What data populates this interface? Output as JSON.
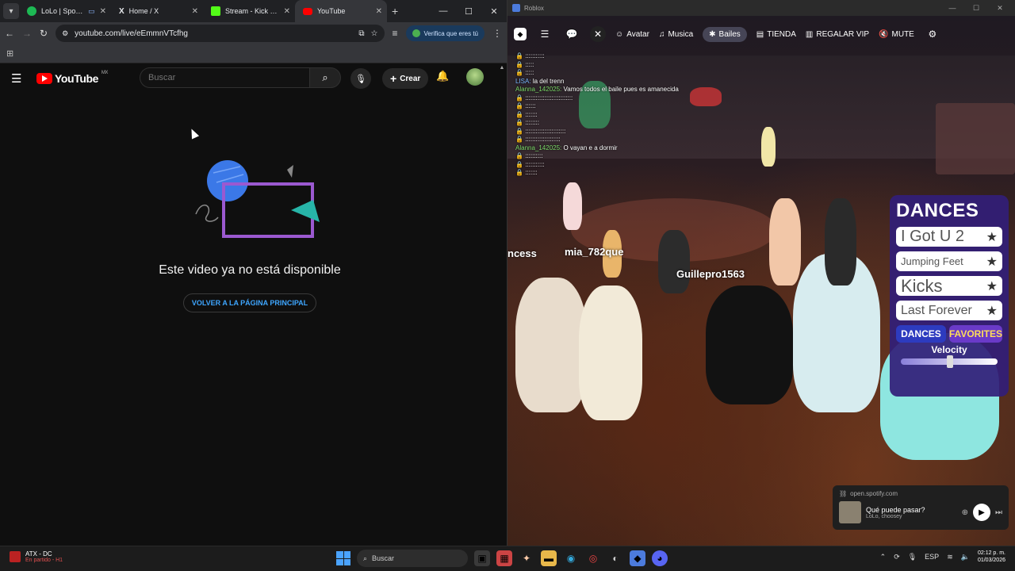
{
  "chrome": {
    "tabs": [
      {
        "title": "LoLo | Spotify",
        "color": "#1db954"
      },
      {
        "title": "Home / X",
        "color": "#ffffff"
      },
      {
        "title": "Stream - Kick Dashb",
        "color": "#53fc18"
      },
      {
        "title": "YouTube",
        "color": "#ff0000"
      }
    ],
    "url": "youtube.com/live/eEmmnVTcfhg",
    "verify_label": "Verifica que eres tú"
  },
  "youtube": {
    "logo_text": "YouTube",
    "region": "MX",
    "search_placeholder": "Buscar",
    "create_label": "Crear",
    "message": "Este video ya no está disponible",
    "back_button": "VOLVER A LA PÁGINA PRINCIPAL"
  },
  "roblox": {
    "window_title": "Roblox",
    "menu": {
      "avatar": "Avatar",
      "music": "Musica",
      "dances": "Bailes",
      "store": "TIENDA",
      "gift": "REGALAR VIP",
      "mute": "MUTE"
    },
    "chat": [
      {
        "locked": true,
        "name": "",
        "text": ":::::::::::"
      },
      {
        "locked": true,
        "name": "",
        "text": ":::::"
      },
      {
        "locked": true,
        "name": "",
        "text": ":::::"
      },
      {
        "locked": false,
        "name": "LISA:",
        "text": "la del trenn",
        "kind": "lisa"
      },
      {
        "locked": false,
        "name": "Alanna_142025:",
        "text": "Vamos todos el baile pues es amanecida",
        "kind": "al"
      },
      {
        "locked": true,
        "name": "",
        "text": ":::::::::::::::::::::::::::"
      },
      {
        "locked": true,
        "name": "",
        "text": "::::::"
      },
      {
        "locked": true,
        "name": "",
        "text": ":::::::"
      },
      {
        "locked": true,
        "name": "",
        "text": "::::::::"
      },
      {
        "locked": true,
        "name": "",
        "text": ":::::::::::::::::::::::"
      },
      {
        "locked": true,
        "name": "",
        "text": "::::::::::::::::::::"
      },
      {
        "locked": false,
        "name": "Alanna_142025:",
        "text": "O vayan e a dormir",
        "kind": "al"
      },
      {
        "locked": true,
        "name": "",
        "text": "::::::::::"
      },
      {
        "locked": true,
        "name": "",
        "text": ":::::::::::"
      },
      {
        "locked": true,
        "name": "",
        "text": ":::::::"
      }
    ],
    "nameplates": [
      "ncess",
      "mia_782que",
      "Guillepro1563"
    ],
    "dances_panel": {
      "title": "DANCES",
      "items": [
        "I Got U 2",
        "Jumping Feet",
        "Kicks",
        "Last Forever"
      ],
      "tab_dances": "DANCES",
      "tab_favorites": "FAVORITES",
      "velocity_label": "Velocity"
    },
    "spotify": {
      "source": "open.spotify.com",
      "track": "Qué puede pasar?",
      "artist": "LoLo, choosey"
    }
  },
  "taskbar": {
    "game_title": "ATX - DC",
    "game_status": "En partido - H1",
    "search_label": "Buscar",
    "lang": "ESP",
    "time": "02:12 p. m.",
    "date": "01/03/2026"
  }
}
